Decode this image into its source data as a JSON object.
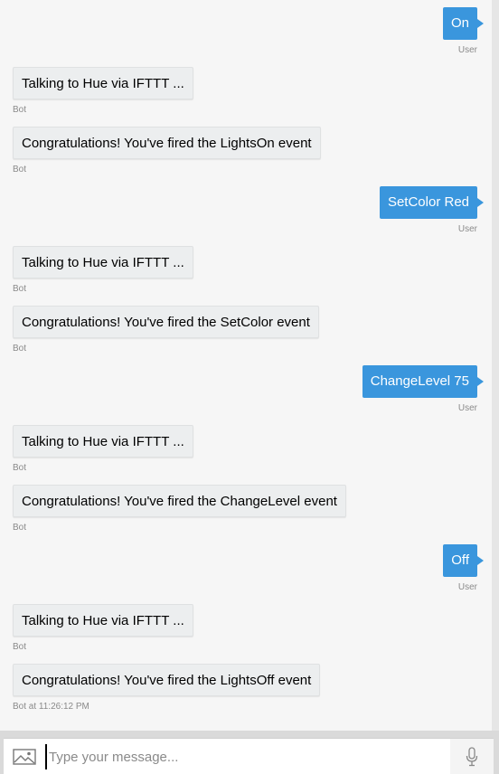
{
  "messages": [
    {
      "from": "user",
      "text": "On",
      "meta": "User"
    },
    {
      "from": "bot",
      "text": "Talking to Hue via IFTTT ...",
      "meta": "Bot"
    },
    {
      "from": "bot",
      "text": "Congratulations! You've fired the LightsOn event",
      "meta": "Bot"
    },
    {
      "from": "user",
      "text": "SetColor Red",
      "meta": "User"
    },
    {
      "from": "bot",
      "text": "Talking to Hue via IFTTT ...",
      "meta": "Bot"
    },
    {
      "from": "bot",
      "text": "Congratulations! You've fired the SetColor event",
      "meta": "Bot"
    },
    {
      "from": "user",
      "text": "ChangeLevel 75",
      "meta": "User"
    },
    {
      "from": "bot",
      "text": "Talking to Hue via IFTTT ...",
      "meta": "Bot"
    },
    {
      "from": "bot",
      "text": "Congratulations! You've fired the ChangeLevel event",
      "meta": "Bot"
    },
    {
      "from": "user",
      "text": "Off",
      "meta": "User"
    },
    {
      "from": "bot",
      "text": "Talking to Hue via IFTTT ...",
      "meta": "Bot"
    },
    {
      "from": "bot",
      "text": "Congratulations! You've fired the LightsOff event",
      "meta": "Bot at 11:26:12 PM"
    }
  ],
  "input": {
    "placeholder": "Type your message...",
    "value": "",
    "upload_icon": "image-upload-icon",
    "mic_icon": "microphone-icon"
  },
  "colors": {
    "user_bubble": "#3a96dd",
    "bot_bubble": "#eceeef",
    "background": "#f6f6f6"
  }
}
